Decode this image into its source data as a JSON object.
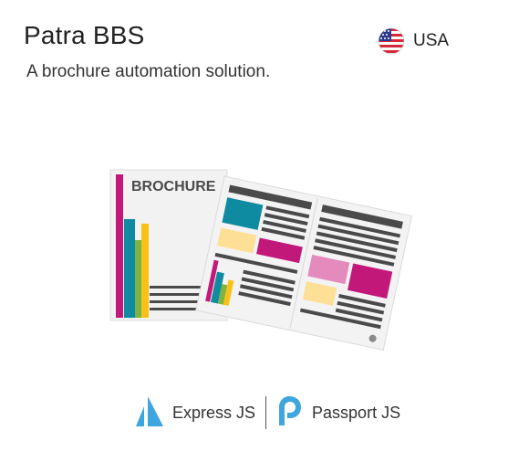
{
  "header": {
    "title": "Patra BBS",
    "subtitle": "A brochure automation solution.",
    "country": "USA",
    "flag_icon": "us-flag-icon"
  },
  "illustration": {
    "icon": "brochure-illustration",
    "brochure_label": "BROCHURE",
    "colors": {
      "magenta": "#c2187a",
      "teal": "#0e8ba0",
      "green": "#7cb342",
      "yellow": "#f9c117",
      "light_yellow": "#fddf95",
      "pink": "#e48abd",
      "dark_gray": "#4a4a4a",
      "paper": "#f2f2f2"
    }
  },
  "tech": {
    "items": [
      {
        "label": "Express JS",
        "icon": "express-js-icon"
      },
      {
        "label": "Passport JS",
        "icon": "passport-js-icon"
      }
    ],
    "accent_color": "#3ea6dc"
  }
}
